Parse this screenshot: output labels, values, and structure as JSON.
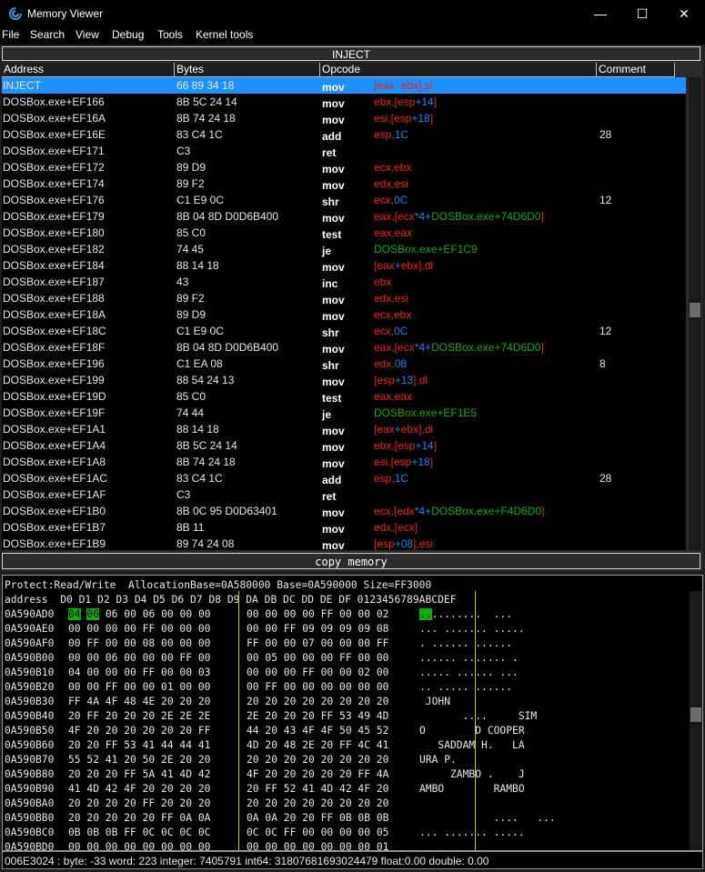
{
  "window": {
    "title": "Memory Viewer",
    "minimize": "—",
    "maximize": "☐",
    "close": "✕"
  },
  "menu": [
    "File",
    "Search",
    "View",
    "Debug",
    "Tools",
    "Kernel tools"
  ],
  "disassembler": {
    "header_button": "INJECT",
    "columns": {
      "address": "Address",
      "bytes": "Bytes",
      "opcode": "Opcode",
      "comment": "Comment"
    },
    "rows": [
      {
        "addr": "INJECT",
        "bytes": "66 89 34 18",
        "mn": "mov",
        "ops": [
          [
            "[",
            "reg"
          ],
          [
            "eax",
            "reg"
          ],
          [
            "+",
            "num"
          ],
          [
            "ebx",
            "reg"
          ],
          [
            "],",
            "reg"
          ],
          [
            "si",
            "reg"
          ]
        ],
        "cmt": ""
      },
      {
        "addr": "DOSBox.exe+EF166",
        "bytes": "8B 5C 24 14",
        "mn": "mov",
        "ops": [
          [
            "ebx,[esp",
            "reg"
          ],
          [
            "+14",
            "num"
          ],
          [
            "]",
            "reg"
          ]
        ],
        "cmt": ""
      },
      {
        "addr": "DOSBox.exe+EF16A",
        "bytes": "8B 74 24 18",
        "mn": "mov",
        "ops": [
          [
            "esi,[esp",
            "reg"
          ],
          [
            "+18",
            "num"
          ],
          [
            "]",
            "reg"
          ]
        ],
        "cmt": ""
      },
      {
        "addr": "DOSBox.exe+EF16E",
        "bytes": "83 C4 1C",
        "mn": "add",
        "ops": [
          [
            "esp,",
            "reg"
          ],
          [
            "1C",
            "num"
          ]
        ],
        "cmt": "28"
      },
      {
        "addr": "DOSBox.exe+EF171",
        "bytes": "C3",
        "mn": "ret",
        "ops": [],
        "cmt": ""
      },
      {
        "addr": "DOSBox.exe+EF172",
        "bytes": "89 D9",
        "mn": "mov",
        "ops": [
          [
            "ecx,ebx",
            "reg"
          ]
        ],
        "cmt": ""
      },
      {
        "addr": "DOSBox.exe+EF174",
        "bytes": "89 F2",
        "mn": "mov",
        "ops": [
          [
            "edx,esi",
            "reg"
          ]
        ],
        "cmt": ""
      },
      {
        "addr": "DOSBox.exe+EF176",
        "bytes": "C1 E9 0C",
        "mn": "shr",
        "ops": [
          [
            "ecx,",
            "reg"
          ],
          [
            "0C",
            "num"
          ]
        ],
        "cmt": "12"
      },
      {
        "addr": "DOSBox.exe+EF179",
        "bytes": "8B 04 8D D0D6B400",
        "mn": "mov",
        "ops": [
          [
            "eax,[ecx",
            "reg"
          ],
          [
            "*",
            "num"
          ],
          [
            "4",
            "num"
          ],
          [
            "+",
            "num"
          ],
          [
            "DOSBox.exe+74D6D0",
            "sym"
          ],
          [
            "]",
            "reg"
          ]
        ],
        "cmt": ""
      },
      {
        "addr": "DOSBox.exe+EF180",
        "bytes": "85 C0",
        "mn": "test",
        "ops": [
          [
            "eax,eax",
            "reg"
          ]
        ],
        "cmt": ""
      },
      {
        "addr": "DOSBox.exe+EF182",
        "bytes": "74 45",
        "mn": "je",
        "ops": [
          [
            "DOSBox.exe+EF1C9",
            "sym"
          ]
        ],
        "cmt": ""
      },
      {
        "addr": "DOSBox.exe+EF184",
        "bytes": "88 14 18",
        "mn": "mov",
        "ops": [
          [
            "[eax",
            "reg"
          ],
          [
            "+",
            "num"
          ],
          [
            "ebx",
            "reg"
          ],
          [
            "],dl",
            "reg"
          ]
        ],
        "cmt": ""
      },
      {
        "addr": "DOSBox.exe+EF187",
        "bytes": "43",
        "mn": "inc",
        "ops": [
          [
            "ebx",
            "reg"
          ]
        ],
        "cmt": ""
      },
      {
        "addr": "DOSBox.exe+EF188",
        "bytes": "89 F2",
        "mn": "mov",
        "ops": [
          [
            "edx,esi",
            "reg"
          ]
        ],
        "cmt": ""
      },
      {
        "addr": "DOSBox.exe+EF18A",
        "bytes": "89 D9",
        "mn": "mov",
        "ops": [
          [
            "ecx,ebx",
            "reg"
          ]
        ],
        "cmt": ""
      },
      {
        "addr": "DOSBox.exe+EF18C",
        "bytes": "C1 E9 0C",
        "mn": "shr",
        "ops": [
          [
            "ecx,",
            "reg"
          ],
          [
            "0C",
            "num"
          ]
        ],
        "cmt": "12"
      },
      {
        "addr": "DOSBox.exe+EF18F",
        "bytes": "8B 04 8D D0D6B400",
        "mn": "mov",
        "ops": [
          [
            "eax,[ecx",
            "reg"
          ],
          [
            "*",
            "num"
          ],
          [
            "4",
            "num"
          ],
          [
            "+",
            "num"
          ],
          [
            "DOSBox.exe+74D6D0",
            "sym"
          ],
          [
            "]",
            "reg"
          ]
        ],
        "cmt": ""
      },
      {
        "addr": "DOSBox.exe+EF196",
        "bytes": "C1 EA 08",
        "mn": "shr",
        "ops": [
          [
            "edx,",
            "reg"
          ],
          [
            "08",
            "num"
          ]
        ],
        "cmt": "8"
      },
      {
        "addr": "DOSBox.exe+EF199",
        "bytes": "88 54 24 13",
        "mn": "mov",
        "ops": [
          [
            "[esp",
            "reg"
          ],
          [
            "+13",
            "num"
          ],
          [
            "],dl",
            "reg"
          ]
        ],
        "cmt": ""
      },
      {
        "addr": "DOSBox.exe+EF19D",
        "bytes": "85 C0",
        "mn": "test",
        "ops": [
          [
            "eax,eax",
            "reg"
          ]
        ],
        "cmt": ""
      },
      {
        "addr": "DOSBox.exe+EF19F",
        "bytes": "74 44",
        "mn": "je",
        "ops": [
          [
            "DOSBox.exe+EF1E5",
            "sym"
          ]
        ],
        "cmt": ""
      },
      {
        "addr": "DOSBox.exe+EF1A1",
        "bytes": "88 14 18",
        "mn": "mov",
        "ops": [
          [
            "[eax",
            "reg"
          ],
          [
            "+",
            "num"
          ],
          [
            "ebx",
            "reg"
          ],
          [
            "],dl",
            "reg"
          ]
        ],
        "cmt": ""
      },
      {
        "addr": "DOSBox.exe+EF1A4",
        "bytes": "8B 5C 24 14",
        "mn": "mov",
        "ops": [
          [
            "ebx,[esp",
            "reg"
          ],
          [
            "+14",
            "num"
          ],
          [
            "]",
            "reg"
          ]
        ],
        "cmt": ""
      },
      {
        "addr": "DOSBox.exe+EF1A8",
        "bytes": "8B 74 24 18",
        "mn": "mov",
        "ops": [
          [
            "esi,[esp",
            "reg"
          ],
          [
            "+18",
            "num"
          ],
          [
            "]",
            "reg"
          ]
        ],
        "cmt": ""
      },
      {
        "addr": "DOSBox.exe+EF1AC",
        "bytes": "83 C4 1C",
        "mn": "add",
        "ops": [
          [
            "esp,",
            "reg"
          ],
          [
            "1C",
            "num"
          ]
        ],
        "cmt": "28"
      },
      {
        "addr": "DOSBox.exe+EF1AF",
        "bytes": "C3",
        "mn": "ret",
        "ops": [],
        "cmt": ""
      },
      {
        "addr": "DOSBox.exe+EF1B0",
        "bytes": "8B 0C 95 D0D63401",
        "mn": "mov",
        "ops": [
          [
            "ecx,[edx",
            "reg"
          ],
          [
            "*",
            "num"
          ],
          [
            "4",
            "num"
          ],
          [
            "+",
            "num"
          ],
          [
            "DOSBox.exe+F4D6D0",
            "sym"
          ],
          [
            "]",
            "reg"
          ]
        ],
        "cmt": ""
      },
      {
        "addr": "DOSBox.exe+EF1B7",
        "bytes": "8B 11",
        "mn": "mov",
        "ops": [
          [
            "edx,[ecx]",
            "reg"
          ]
        ],
        "cmt": ""
      },
      {
        "addr": "DOSBox.exe+EF1B9",
        "bytes": "89 74 24 08",
        "mn": "mov",
        "ops": [
          [
            "[esp",
            "reg"
          ],
          [
            "+08",
            "num"
          ],
          [
            "],esi",
            "reg"
          ]
        ],
        "cmt": ""
      }
    ],
    "selected_index": 0
  },
  "copy_memory_button": "copy memory",
  "hexview": {
    "info": "Protect:Read/Write  AllocationBase=0A580000 Base=0A590000 Size=FF3000",
    "header": "address  D0 D1 D2 D3 D4 D5 D6 D7 D8 D9 DA DB DC DD DE DF 0123456789ABCDEF",
    "rows": [
      {
        "addr": "0A590AD0",
        "b1": "04 00 06 00 06 00 00 00",
        "b2": "00 00 00 00 FF 00 00 02",
        "ascii": "..........  ..."
      },
      {
        "addr": "0A590AE0",
        "b1": "00 00 00 00 FF 00 00 00",
        "b2": "00 00 FF 09 09 09 09 08",
        "ascii": "... ....... ....."
      },
      {
        "addr": "0A590AF0",
        "b1": "00 FF 00 00 08 00 00 00",
        "b2": "FF 00 00 07 00 00 00 FF",
        "ascii": ". ...... ......"
      },
      {
        "addr": "0A590B00",
        "b1": "00 00 06 00 00 00 FF 00",
        "b2": "00 05 00 00 00 FF 00 00",
        "ascii": "...... ....... ."
      },
      {
        "addr": "0A590B10",
        "b1": "04 00 00 00 FF 00 00 03",
        "b2": "00 00 00 FF 00 00 02 00",
        "ascii": "..... ...... ..."
      },
      {
        "addr": "0A590B20",
        "b1": "00 00 FF 00 00 01 00 00",
        "b2": "00 FF 00 00 00 00 00 00",
        "ascii": ".. ..... ......"
      },
      {
        "addr": "0A590B30",
        "b1": "FF 4A 4F 48 4E 20 20 20",
        "b2": "20 20 20 20 20 20 20 20",
        "ascii": " JOHN"
      },
      {
        "addr": "0A590B40",
        "b1": "20 FF 20 20 20 2E 2E 2E",
        "b2": "2E 20 20 20 FF 53 49 4D",
        "ascii": "       ....     SIM"
      },
      {
        "addr": "0A590B50",
        "b1": "4F 20 20 20 20 20 20 FF",
        "b2": "44 20 43 4F 4F 50 45 52",
        "ascii": "O        D COOPER"
      },
      {
        "addr": "0A590B60",
        "b1": "20 20 FF 53 41 44 44 41",
        "b2": "4D 20 48 2E 20 FF 4C 41",
        "ascii": "   SADDAM H.   LA"
      },
      {
        "addr": "0A590B70",
        "b1": "55 52 41 20 50 2E 20 20",
        "b2": "20 20 20 20 20 20 20 20",
        "ascii": "URA P."
      },
      {
        "addr": "0A590B80",
        "b1": "20 20 20 FF 5A 41 4D 42",
        "b2": "4F 20 20 20 20 20 FF 4A",
        "ascii": "     ZAMBO .    J"
      },
      {
        "addr": "0A590B90",
        "b1": "41 4D 42 4F 20 20 20 20",
        "b2": "20 FF 52 41 4D 42 4F 20",
        "ascii": "AMBO        RAMBO"
      },
      {
        "addr": "0A590BA0",
        "b1": "20 20 20 20 FF 20 20 20",
        "b2": "20 20 20 20 20 20 20 20",
        "ascii": ""
      },
      {
        "addr": "0A590BB0",
        "b1": "20 20 20 20 20 FF 0A 0A",
        "b2": "0A 0A 20 20 FF 0B 0B 0B",
        "ascii": "            ....   ..."
      },
      {
        "addr": "0A590BC0",
        "b1": "0B 0B 0B FF 0C 0C 0C 0C",
        "b2": "0C 0C FF 00 00 00 00 05",
        "ascii": "... ....... ....."
      },
      {
        "addr": "0A590BD0",
        "b1": "00 00 00 00 00 00 00 00",
        "b2": "00 00 00 00 00 00 00 01",
        "ascii": ""
      }
    ],
    "highlight_bytes": [
      "04",
      "00"
    ],
    "highlight_ascii": ".."
  },
  "status": "006E3024 : byte: -33 word: 223 integer: 7405791 int64: 31807681693024479 float:0.00 double: 0.00",
  "colors": {
    "reg": "#e0281e",
    "num": "#1e82e6",
    "sym": "#17a31d",
    "selection": "#1e90ff",
    "highlight": "#00b200",
    "separator": "#d8c000"
  }
}
